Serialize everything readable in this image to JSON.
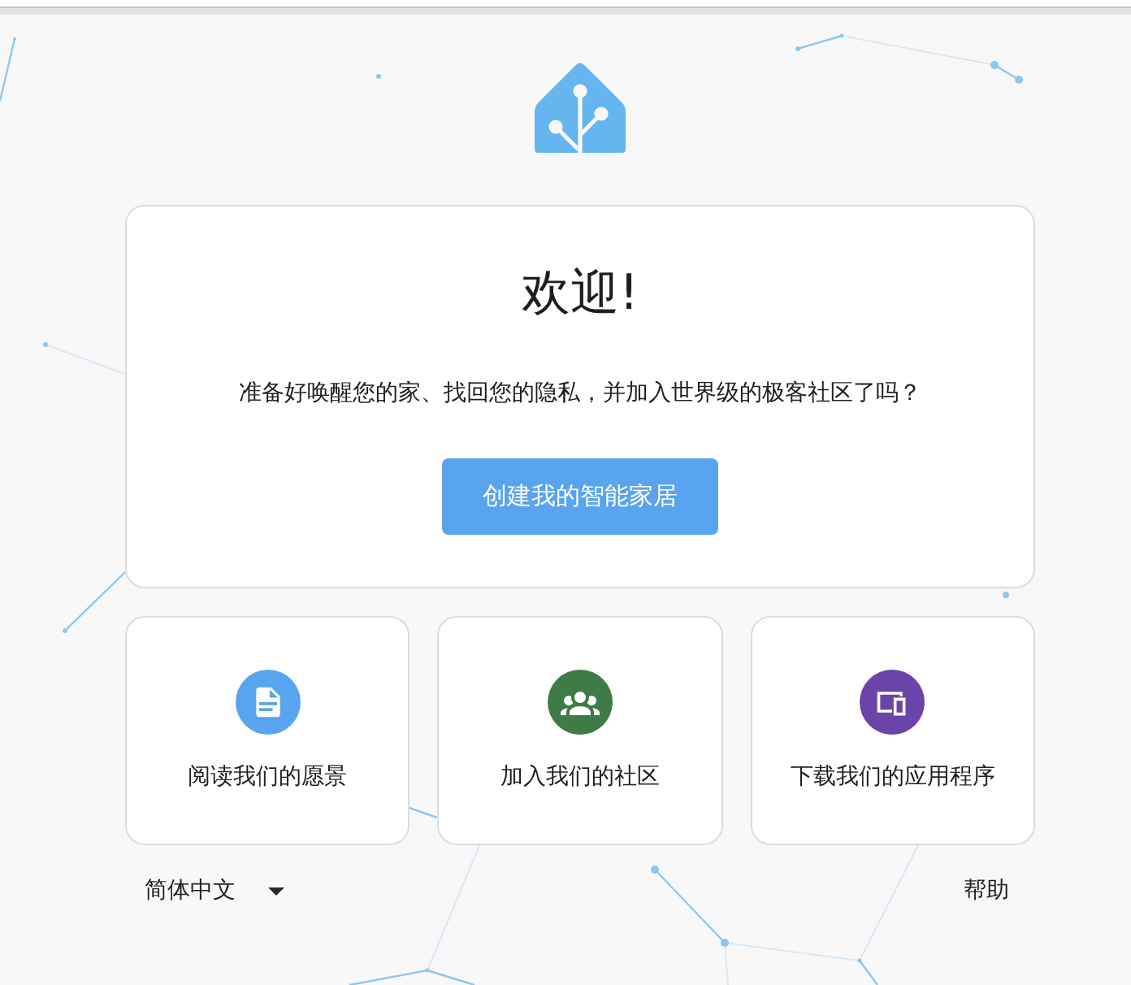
{
  "welcome_card": {
    "title": "欢迎!",
    "message": "准备好唤醒您的家、找回您的隐私，并加入世界级的极客社区了吗？",
    "button": "创建我的智能家居"
  },
  "link_cards": [
    {
      "kind": "document",
      "color": "#59a4ee",
      "label": "阅读我们的愿景"
    },
    {
      "kind": "group",
      "color": "#3e7b47",
      "label": "加入我们的社区"
    },
    {
      "kind": "devices",
      "color": "#6a44a8",
      "label": "下载我们的应用程序"
    }
  ],
  "footer": {
    "language": {
      "value": "简体中文"
    },
    "help_link": "帮助"
  }
}
